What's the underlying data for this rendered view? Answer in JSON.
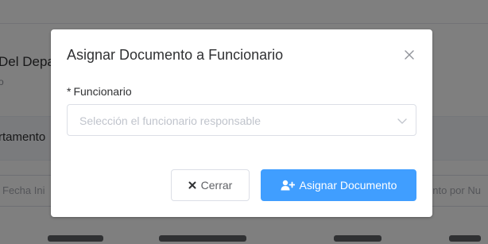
{
  "background": {
    "heading_fragment": "Del Depa",
    "sub_fragment": "o",
    "band_label_fragment": "rtamento",
    "filter_left_placeholder": "Fecha Ini",
    "filter_right_placeholder": "ento por Nu"
  },
  "dialog": {
    "title": "Asignar Documento a Funcionario",
    "close_icon": "close-icon",
    "form": {
      "required_mark": "*",
      "label": "Funcionario",
      "select_placeholder": "Selección el funcionario responsable",
      "select_icon": "chevron-down-icon"
    },
    "buttons": {
      "cancel_label": "Cerrar",
      "cancel_icon": "close-icon",
      "primary_label": "Asignar Documento",
      "primary_icon": "user-plus-icon"
    }
  },
  "colors": {
    "primary": "#409eff",
    "overlay": "rgba(0,0,0,0.5)",
    "border": "#dcdfe6",
    "placeholder": "#c0c4cc"
  }
}
